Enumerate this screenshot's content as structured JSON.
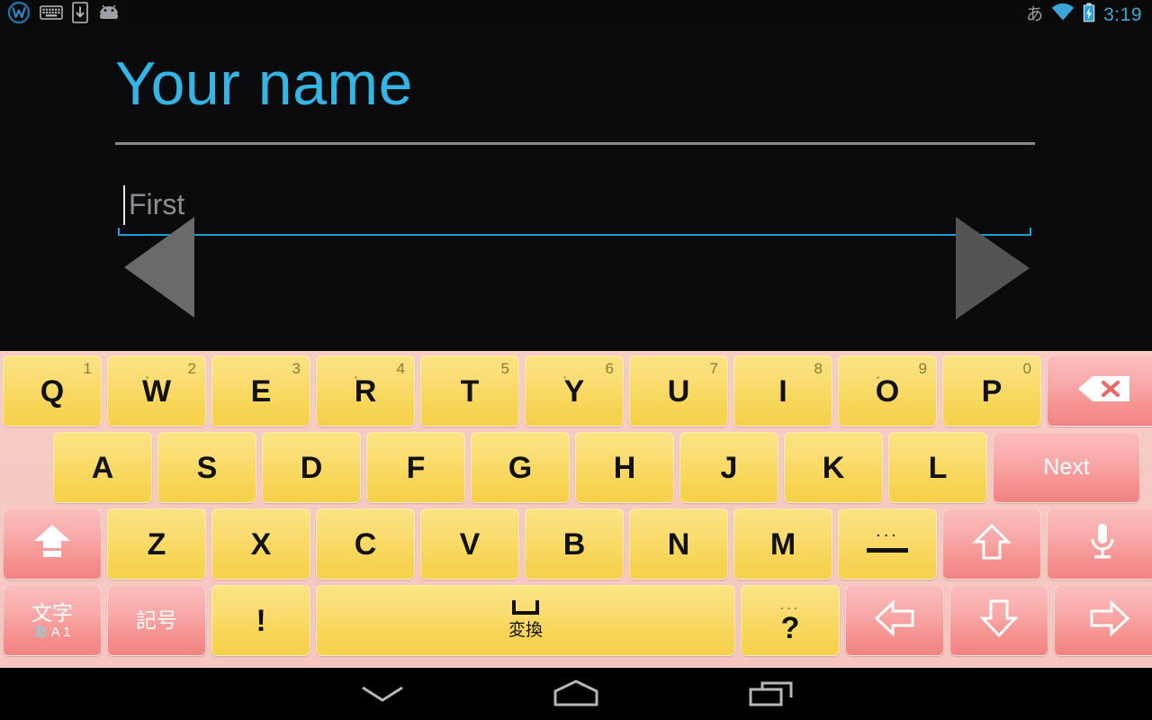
{
  "statusbar": {
    "time": "3:19",
    "ime_indicator": "あ",
    "left_icons": [
      {
        "name": "app-notification-icon",
        "glyph": "w-circle"
      },
      {
        "name": "keyboard-notification-icon",
        "glyph": "keyboard"
      },
      {
        "name": "download-notification-icon",
        "glyph": "download"
      },
      {
        "name": "android-notification-icon",
        "glyph": "android"
      }
    ],
    "right_icons": [
      {
        "name": "wifi-icon",
        "glyph": "wifi"
      },
      {
        "name": "battery-charging-icon",
        "glyph": "battery-charging"
      }
    ],
    "clock_color": "#3ba7d6"
  },
  "content": {
    "title": "Your name",
    "title_color": "#33b5e5",
    "name_field": {
      "value": "",
      "placeholder": "First",
      "underline_color": "#1a9fd4"
    },
    "prev_button_label": "Previous",
    "next_button_label": "Next"
  },
  "keyboard": {
    "background_color": "#f6c9c2",
    "key_yellow": "#f7d557",
    "key_pink": "#f4908e",
    "row1": [
      {
        "name": "key-q",
        "label": "Q",
        "sup": "1",
        "style": "yellow",
        "dot": false
      },
      {
        "name": "key-w",
        "label": "W",
        "sup": "2",
        "style": "yellow",
        "dot": true
      },
      {
        "name": "key-e",
        "label": "E",
        "sup": "3",
        "style": "yellow",
        "dot": false
      },
      {
        "name": "key-r",
        "label": "R",
        "sup": "4",
        "style": "yellow",
        "dot": true
      },
      {
        "name": "key-t",
        "label": "T",
        "sup": "5",
        "style": "yellow",
        "dot": false
      },
      {
        "name": "key-y",
        "label": "Y",
        "sup": "6",
        "style": "yellow",
        "dot": true
      },
      {
        "name": "key-u",
        "label": "U",
        "sup": "7",
        "style": "yellow",
        "dot": false
      },
      {
        "name": "key-i",
        "label": "I",
        "sup": "8",
        "style": "yellow",
        "dot": false
      },
      {
        "name": "key-o",
        "label": "O",
        "sup": "9",
        "style": "yellow",
        "dot": true
      },
      {
        "name": "key-p",
        "label": "P",
        "sup": "0",
        "style": "yellow",
        "dot": false
      },
      {
        "name": "key-backspace",
        "label": "",
        "icon": "backspace-icon",
        "style": "pink"
      }
    ],
    "row2": [
      {
        "name": "key-a",
        "label": "A",
        "style": "yellow"
      },
      {
        "name": "key-s",
        "label": "S",
        "style": "yellow"
      },
      {
        "name": "key-d",
        "label": "D",
        "style": "yellow"
      },
      {
        "name": "key-f",
        "label": "F",
        "style": "yellow"
      },
      {
        "name": "key-g",
        "label": "G",
        "style": "yellow"
      },
      {
        "name": "key-h",
        "label": "H",
        "style": "yellow"
      },
      {
        "name": "key-j",
        "label": "J",
        "style": "yellow"
      },
      {
        "name": "key-k",
        "label": "K",
        "style": "yellow"
      },
      {
        "name": "key-l",
        "label": "L",
        "style": "yellow"
      },
      {
        "name": "key-next",
        "label": "Next",
        "style": "pink"
      }
    ],
    "row3": [
      {
        "name": "key-shift",
        "label": "",
        "icon": "shift-caps-icon",
        "style": "pink"
      },
      {
        "name": "key-z",
        "label": "Z",
        "style": "yellow"
      },
      {
        "name": "key-x",
        "label": "X",
        "style": "yellow"
      },
      {
        "name": "key-c",
        "label": "C",
        "style": "yellow"
      },
      {
        "name": "key-v",
        "label": "V",
        "style": "yellow"
      },
      {
        "name": "key-b",
        "label": "B",
        "style": "yellow"
      },
      {
        "name": "key-n",
        "label": "N",
        "style": "yellow"
      },
      {
        "name": "key-m",
        "label": "M",
        "style": "yellow"
      },
      {
        "name": "key-dash",
        "label": "—",
        "dots": "...",
        "style": "yellow"
      },
      {
        "name": "key-arrow-up",
        "label": "",
        "icon": "arrow-up-icon",
        "style": "pink"
      },
      {
        "name": "key-microphone",
        "label": "",
        "icon": "microphone-icon",
        "style": "pink"
      }
    ],
    "row4": [
      {
        "name": "key-mode-moji",
        "label": "文字",
        "sub_hira": "あ",
        "sub_rest": "A 1",
        "style": "pink"
      },
      {
        "name": "key-symbols-kigou",
        "label": "記号",
        "style": "pink"
      },
      {
        "name": "key-exclamation",
        "label": "!",
        "style": "yellow"
      },
      {
        "name": "key-space-henkan",
        "label": "変換",
        "icon": "space-icon",
        "style": "yellow"
      },
      {
        "name": "key-question",
        "label": "?",
        "dots": "...",
        "style": "yellow"
      },
      {
        "name": "key-arrow-left",
        "label": "",
        "icon": "arrow-left-icon",
        "style": "pink"
      },
      {
        "name": "key-arrow-down",
        "label": "",
        "icon": "arrow-down-icon",
        "style": "pink"
      },
      {
        "name": "key-arrow-right",
        "label": "",
        "icon": "arrow-right-icon",
        "style": "pink"
      }
    ]
  },
  "navbar": {
    "back_label": "Hide keyboard",
    "home_label": "Home",
    "recents_label": "Recent apps"
  }
}
